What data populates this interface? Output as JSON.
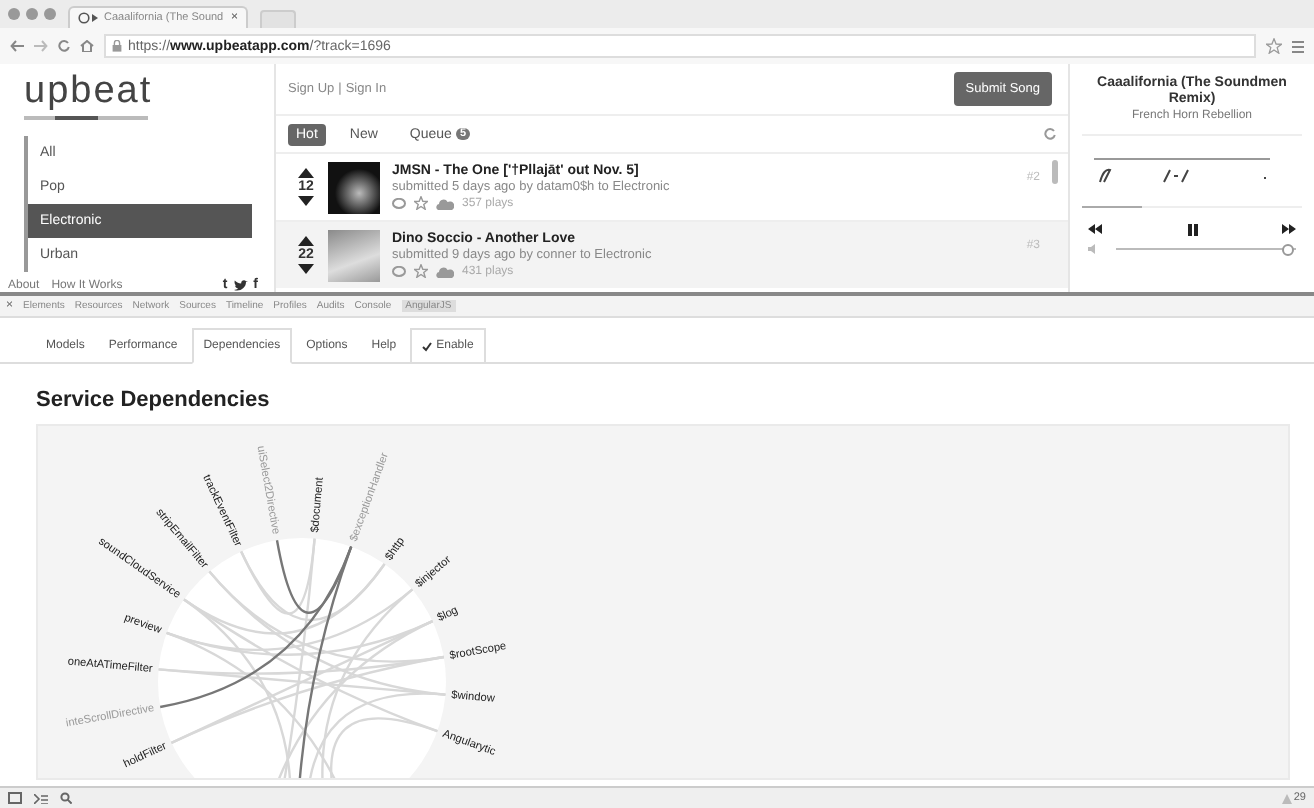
{
  "browser": {
    "tab": {
      "title": "Caaalifornia (The Sound",
      "close": "×"
    },
    "url": "https://**www.upbeatapp.com**/?track=1696"
  },
  "app": {
    "logo": "upbeat",
    "auth_links": [
      "Sign Up",
      "Sign In"
    ],
    "auth_separator": "|",
    "submit_button": "Submit Song",
    "genres": [
      {
        "label": "All",
        "selected": false
      },
      {
        "label": "Pop",
        "selected": false
      },
      {
        "label": "Electronic",
        "selected": true
      },
      {
        "label": "Urban",
        "selected": false
      }
    ],
    "footer_links": [
      "About",
      "How It Works"
    ],
    "social": [
      "t",
      "f"
    ],
    "feed_tabs": [
      {
        "label": "Hot",
        "selected": true
      },
      {
        "label": "New",
        "selected": false
      },
      {
        "label": "Queue",
        "selected": false,
        "badge": "5"
      }
    ],
    "songs": [
      {
        "votes": "12",
        "title": "JMSN - The One ['†Pllajāt' out Nov. 5]",
        "meta": "submitted 5 days ago by datam0$h to Electronic",
        "plays": "357 plays",
        "rank": "#2"
      },
      {
        "votes": "22",
        "title": "Dino Soccio - Another Love",
        "meta": "submitted 9 days ago by conner to Electronic",
        "plays": "431 plays",
        "rank": "#3"
      }
    ],
    "player": {
      "title": "Caaalifornia (The Soundmen Remix)",
      "artist": "French Horn Rebellion",
      "progress": {
        "level": 0.27
      },
      "volume": {
        "level": 0.95
      }
    }
  },
  "devtools": {
    "close": "×",
    "tabs": [
      {
        "label": "Elements",
        "selected": false
      },
      {
        "label": "Resources",
        "selected": false
      },
      {
        "label": "Network",
        "selected": false
      },
      {
        "label": "Sources",
        "selected": false
      },
      {
        "label": "Timeline",
        "selected": false
      },
      {
        "label": "Profiles",
        "selected": false
      },
      {
        "label": "Audits",
        "selected": false
      },
      {
        "label": "Console",
        "selected": false
      },
      {
        "label": "AngularJS",
        "selected": true
      }
    ],
    "angular_tabs": [
      {
        "kind": "tab",
        "label": "Models",
        "selected": false
      },
      {
        "kind": "tab",
        "label": "Performance",
        "selected": false
      },
      {
        "kind": "tab",
        "label": "Dependencies",
        "selected": true
      },
      {
        "kind": "tab",
        "label": "Options",
        "selected": false
      },
      {
        "kind": "tab",
        "label": "Help",
        "selected": false
      },
      {
        "kind": "checkbox",
        "label": "Enable",
        "checked": true
      }
    ],
    "heading": "Service Dependencies",
    "dependency_graph": {
      "nodes": [
        {
          "label": "holdFilter",
          "highlighted": false
        },
        {
          "label": "inteScrollDirective",
          "highlighted": true
        },
        {
          "label": "oneAtATimeFilter",
          "highlighted": false
        },
        {
          "label": "preview",
          "highlighted": false
        },
        {
          "label": "soundCloudService",
          "highlighted": false
        },
        {
          "label": "stripEmailFilter",
          "highlighted": false
        },
        {
          "label": "trackEventFilter",
          "highlighted": false
        },
        {
          "label": "uiSelect2Directive",
          "highlighted": true
        },
        {
          "label": "$document",
          "highlighted": false
        },
        {
          "label": "$exceptionHandler",
          "highlighted": true
        },
        {
          "label": "$http",
          "highlighted": false
        },
        {
          "label": "$injector",
          "highlighted": false
        },
        {
          "label": "$log",
          "highlighted": false
        },
        {
          "label": "$rootScope",
          "highlighted": false
        },
        {
          "label": "$window",
          "highlighted": false
        },
        {
          "label": "Angularytic",
          "highlighted": false
        }
      ]
    },
    "status_bar": {
      "warnings": "29"
    }
  }
}
